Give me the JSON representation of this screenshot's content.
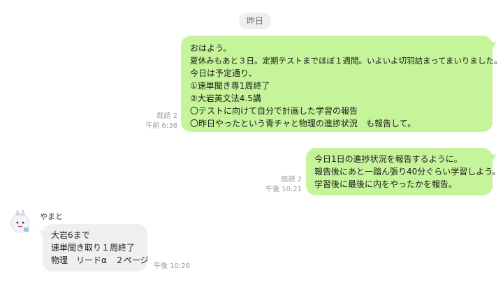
{
  "date_separator": "昨日",
  "messages": [
    {
      "side": "out",
      "lines": [
        "おはよう。",
        "夏休みもあと３日。定期テストまでほぼ１週間。いよいよ切羽詰まってまいりました。",
        "今日は予定通り、",
        "①速単聞き専1周終了",
        "②大岩英文法4.5講",
        "〇テストに向けて自分で計画した学習の報告",
        "〇昨日やったという青チャと物理の進捗状況　も報告して。"
      ],
      "read": "既読 2",
      "time": "午前 6:38"
    },
    {
      "side": "out",
      "lines": [
        "今日1日の進捗状況を報告するように。",
        "報告後にあと一踏ん張り40分ぐらい学習しよう。",
        "学習後に最後に内をやったかを報告。"
      ],
      "read": "既読 2",
      "time": "午後 10:21"
    },
    {
      "side": "in",
      "sender": "やまと",
      "lines": [
        "大岩6まで",
        "速単聞き取り１周終了",
        "物理　リードα　２ページ"
      ],
      "time": "午後 10:26"
    }
  ],
  "colors": {
    "outgoing_bubble": "#c6f49a",
    "incoming_bubble": "#efefef",
    "meta_text": "#9a9a9a"
  },
  "icons": {
    "avatar": "avatar-icon"
  }
}
